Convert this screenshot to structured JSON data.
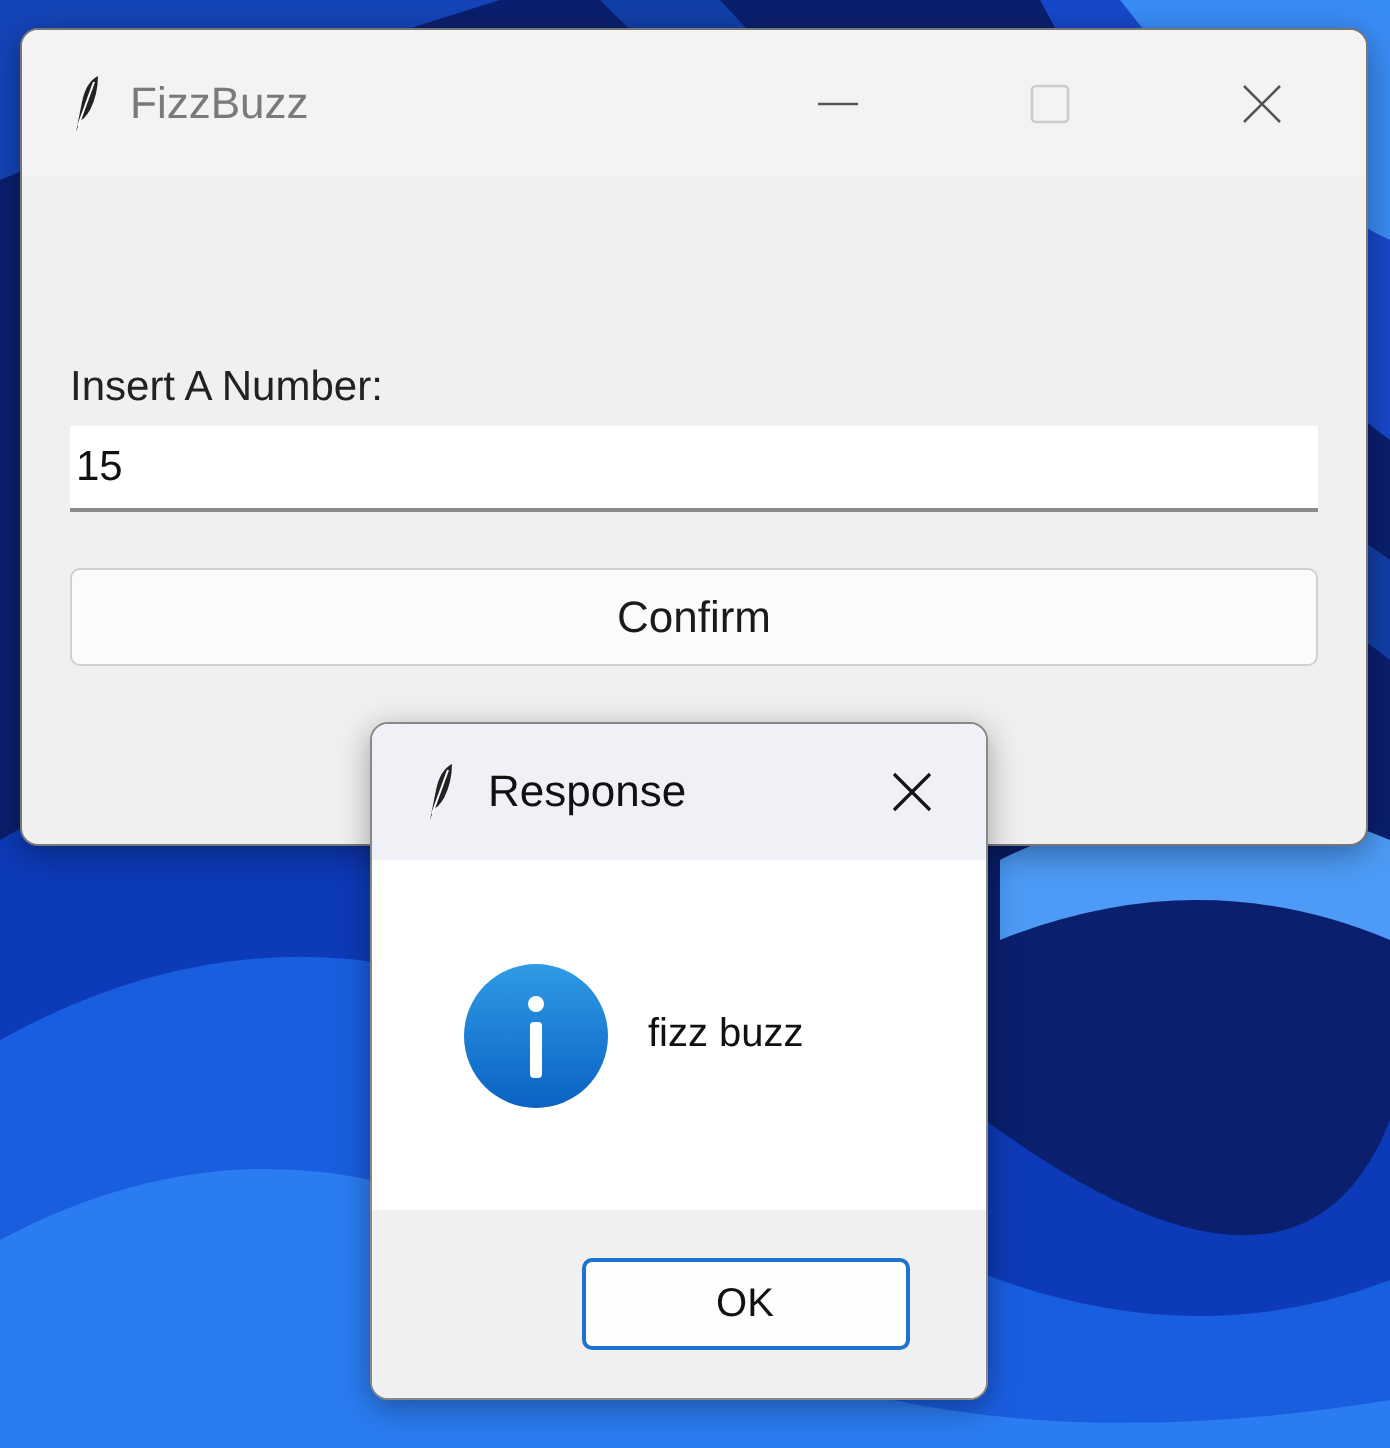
{
  "main_window": {
    "title": "FizzBuzz",
    "label": "Insert A Number:",
    "input": {
      "value": "15"
    },
    "button": "Confirm"
  },
  "dialog": {
    "title": "Response",
    "message": "fizz buzz",
    "button": "OK"
  }
}
